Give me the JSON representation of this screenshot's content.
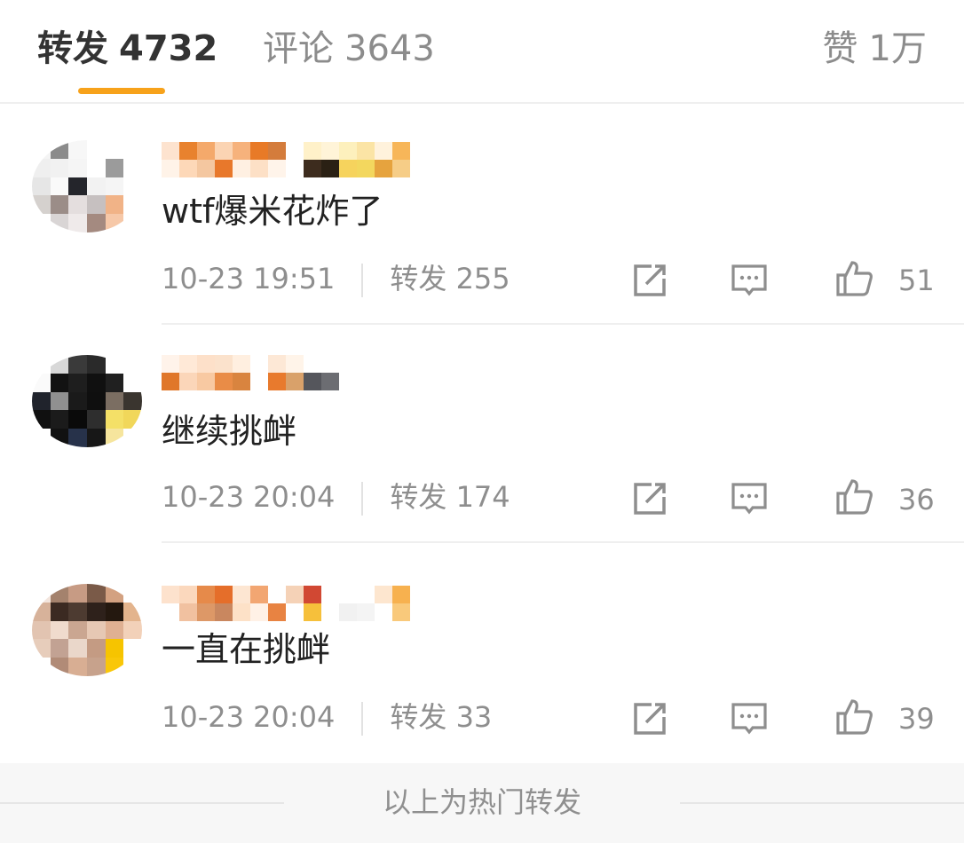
{
  "tabs": {
    "repost": {
      "label": "转发",
      "count": "4732"
    },
    "comment": {
      "label": "评论",
      "count": "3643"
    },
    "like": {
      "label": "赞",
      "count": "1万"
    }
  },
  "colors": {
    "accent": "#f7a21b",
    "text": "#222222",
    "muted": "#8e8e8e"
  },
  "reposts": [
    {
      "text": "wtf爆米花炸了",
      "time": "10-23 19:51",
      "repost_label": "转发",
      "repost_count": "255",
      "like_count": "51"
    },
    {
      "text": "继续挑衅",
      "time": "10-23 20:04",
      "repost_label": "转发",
      "repost_count": "174",
      "like_count": "36"
    },
    {
      "text": "一直在挑衅",
      "time": "10-23 20:04",
      "repost_label": "转发",
      "repost_count": "33",
      "like_count": "39"
    }
  ],
  "icons": {
    "share": "share-icon",
    "comment": "comment-icon",
    "like": "thumbs-up-icon"
  },
  "footer": {
    "text": "以上为热门转发"
  }
}
